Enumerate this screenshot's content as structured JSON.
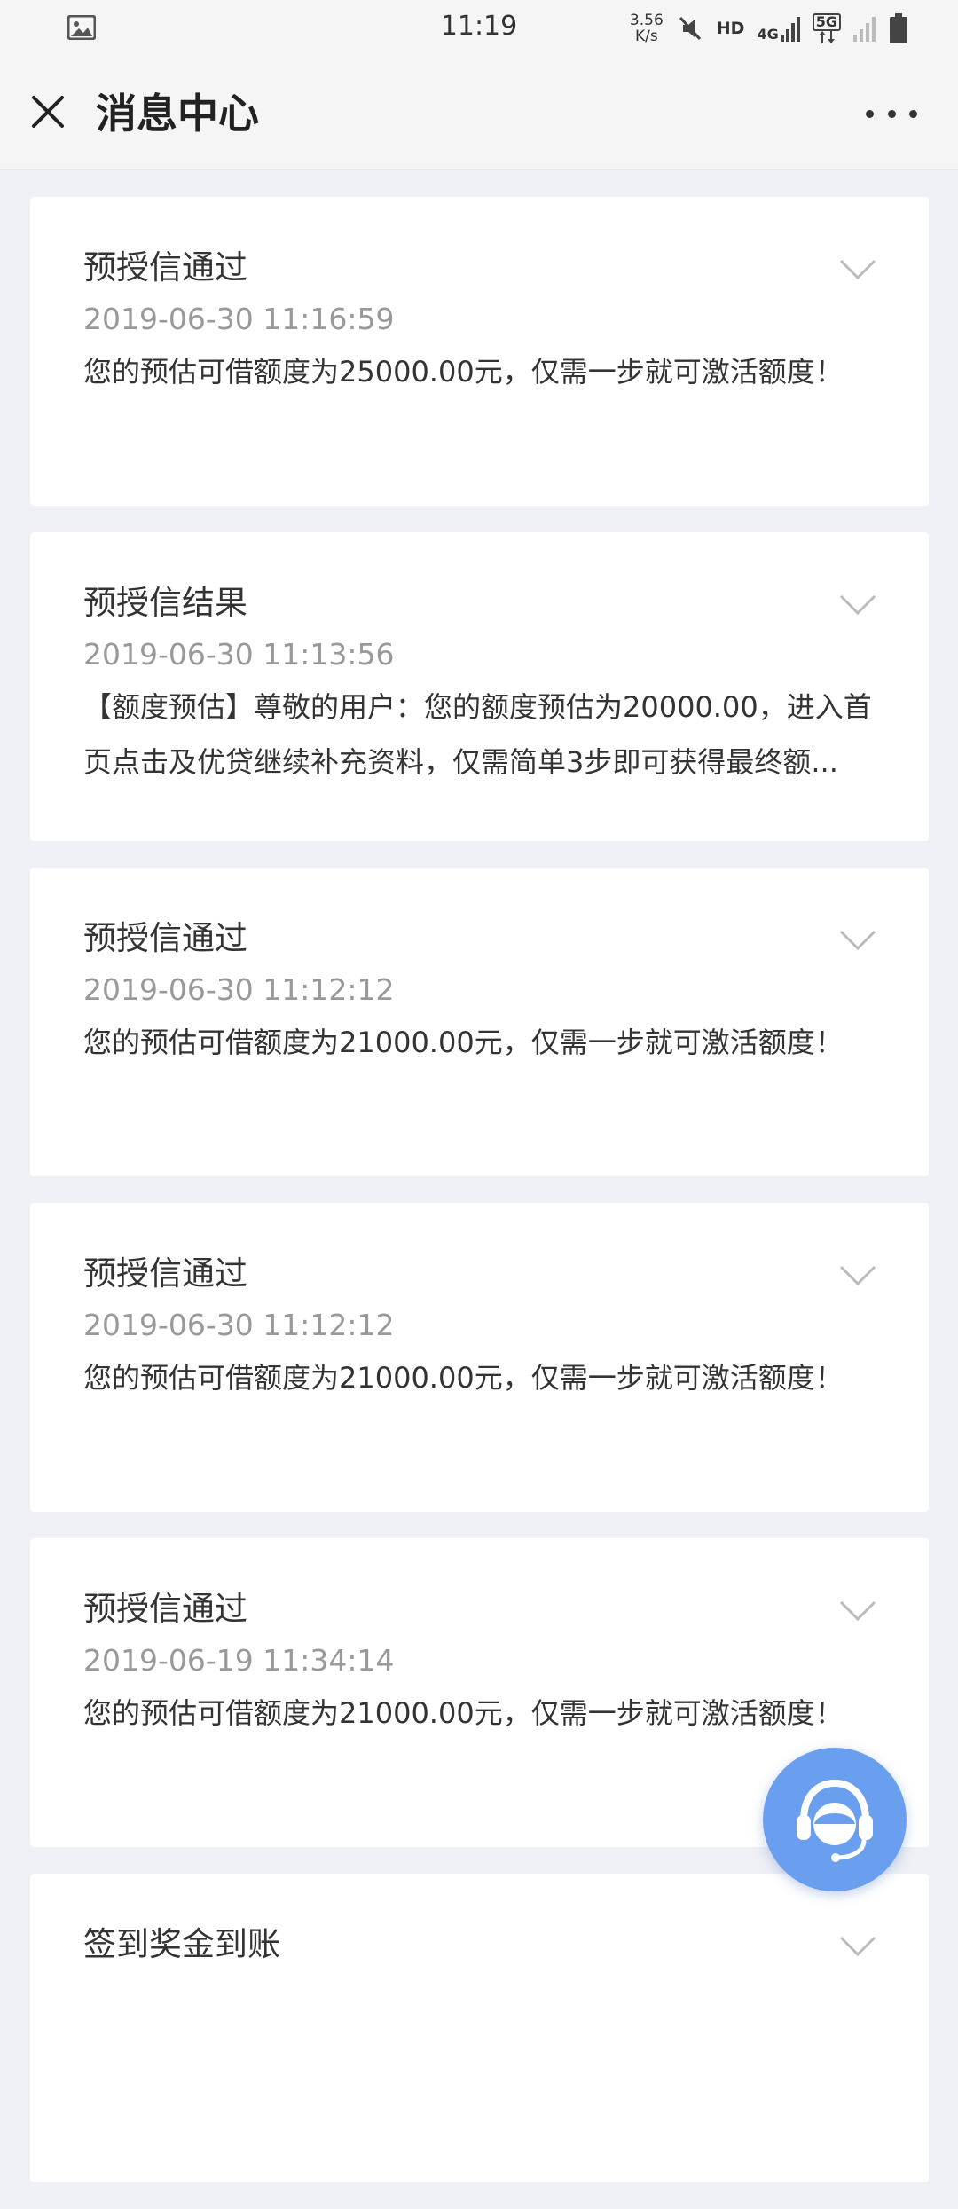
{
  "status_bar": {
    "time": "11:19",
    "speed_value": "3.56",
    "speed_unit": "K/s",
    "hd": "HD",
    "network_4g": "4G",
    "network_5g": "5G",
    "icons": [
      "photo-icon",
      "mute-icon",
      "signal-icon",
      "battery-icon"
    ]
  },
  "nav": {
    "title": "消息中心",
    "icons": [
      "close-icon",
      "more-icon"
    ]
  },
  "messages": [
    {
      "title": "预授信通过",
      "time": "2019-06-30 11:16:59",
      "body": "您的预估可借额度为25000.00元，仅需一步就可激活额度！"
    },
    {
      "title": "预授信结果",
      "time": "2019-06-30 11:13:56",
      "body": "【额度预估】尊敬的用户：您的额度预估为20000.00，进入首页点击及优贷继续补充资料，仅需简单3步即可获得最终额..."
    },
    {
      "title": "预授信通过",
      "time": "2019-06-30 11:12:12",
      "body": "您的预估可借额度为21000.00元，仅需一步就可激活额度！"
    },
    {
      "title": "预授信通过",
      "time": "2019-06-30 11:12:12",
      "body": "您的预估可借额度为21000.00元，仅需一步就可激活额度！"
    },
    {
      "title": "预授信通过",
      "time": "2019-06-19 11:34:14",
      "body": "您的预估可借额度为21000.00元，仅需一步就可激活额度！"
    },
    {
      "title": "签到奖金到账",
      "time": "",
      "body": ""
    }
  ],
  "fab": {
    "icon": "customer-service-icon",
    "color": "#6a9ff0"
  }
}
